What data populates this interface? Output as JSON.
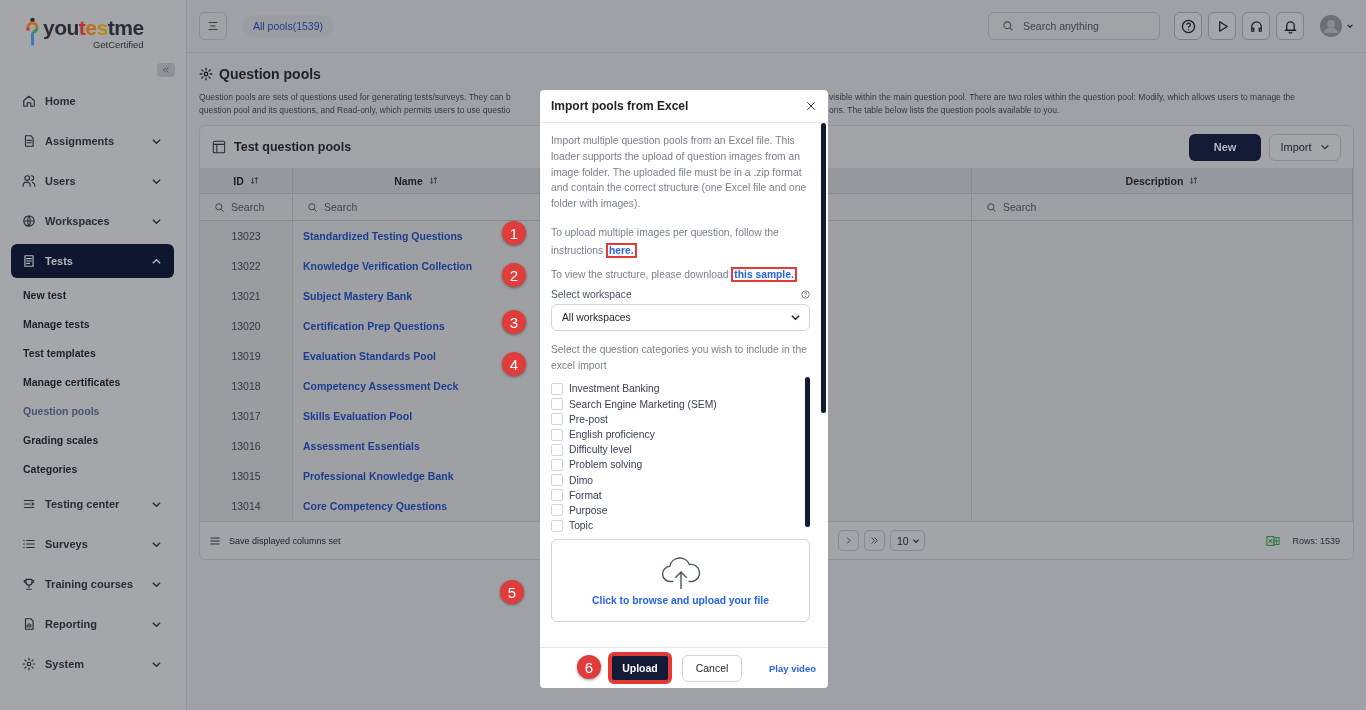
{
  "sidebar": {
    "logo": {
      "wordmark": "youtestme",
      "tagline": "GetCertified"
    },
    "items": [
      {
        "label": "Home",
        "selected": false
      },
      {
        "label": "Assignments",
        "selected": false,
        "expanded": false
      },
      {
        "label": "Users",
        "selected": false,
        "expanded": false
      },
      {
        "label": "Workspaces",
        "selected": false,
        "expanded": false
      },
      {
        "label": "Tests",
        "selected": true,
        "expanded": true,
        "children": [
          {
            "label": "New test",
            "selected": false
          },
          {
            "label": "Manage tests",
            "selected": false
          },
          {
            "label": "Test templates",
            "selected": false
          },
          {
            "label": "Manage certificates",
            "selected": false
          },
          {
            "label": "Question pools",
            "selected": true
          },
          {
            "label": "Grading scales",
            "selected": false
          },
          {
            "label": "Categories",
            "selected": false
          }
        ]
      },
      {
        "label": "Testing center",
        "selected": false,
        "expanded": false
      },
      {
        "label": "Surveys",
        "selected": false,
        "expanded": false
      },
      {
        "label": "Training courses",
        "selected": false,
        "expanded": false
      },
      {
        "label": "Reporting",
        "selected": false,
        "expanded": false
      },
      {
        "label": "System",
        "selected": false,
        "expanded": false
      }
    ]
  },
  "topbar": {
    "chip": "All pools(1539)",
    "search": {
      "placeholder": "Search anything"
    }
  },
  "page": {
    "title": "Question pools",
    "description_left": [
      "Question pools are sets of questions used for generating tests/surveys. They can b",
      "question pool and its questions, and Read-only, which permits users to use questio"
    ],
    "description_right": [
      "visible within the main question pool. There are two roles within the question pool: Modify, which allows users to manage the",
      "ons. The table below lists the question pools available to you."
    ]
  },
  "card": {
    "title": "Test question pools",
    "buttons": [
      {
        "label": "New",
        "kind": "primary"
      },
      {
        "label": "Import",
        "kind": "dropdown"
      }
    ],
    "table": {
      "columns": [
        {
          "label": "ID",
          "placeholder": "Search"
        },
        {
          "label": "Name",
          "placeholder": "Search"
        },
        {
          "label": "Description",
          "placeholder": "Search"
        }
      ],
      "rows": [
        {
          "id": "13023",
          "name": "Standardized Testing Questions"
        },
        {
          "id": "13022",
          "name": "Knowledge Verification Collection"
        },
        {
          "id": "13021",
          "name": "Subject Mastery Bank"
        },
        {
          "id": "13020",
          "name": "Certification Prep Questions"
        },
        {
          "id": "13019",
          "name": "Evaluation Standards Pool"
        },
        {
          "id": "13018",
          "name": "Competency Assessment Deck"
        },
        {
          "id": "13017",
          "name": "Skills Evaluation Pool"
        },
        {
          "id": "13016",
          "name": "Assessment Essentials"
        },
        {
          "id": "13015",
          "name": "Professional Knowledge Bank"
        },
        {
          "id": "13014",
          "name": "Core Competency Questions"
        }
      ]
    },
    "footer": {
      "save_label": "Save displayed columns set",
      "page_size": "10",
      "rows": "Rows: 1539"
    }
  },
  "modal": {
    "title": "Import pools from Excel",
    "intro": "Import multiple question pools from an Excel file. This loader supports the upload of question images from an image folder. The uploaded file must be in a .zip format and contain the correct structure (one Excel file and one folder with images).",
    "instructions": {
      "text": "To upload multiple images per question, follow the instructions",
      "link": "here.",
      "highlighted": true
    },
    "sample": {
      "text": "To view the structure, please download",
      "link": "this sample.",
      "highlighted": true
    },
    "workspace": {
      "label": "Select workspace",
      "value": "All workspaces"
    },
    "categories": {
      "label": "Select the question categories you wish to include in the excel import",
      "items": [
        {
          "label": "Investment Banking",
          "checked": false
        },
        {
          "label": "Search Engine Marketing (SEM)",
          "checked": false
        },
        {
          "label": "Pre-post",
          "checked": false
        },
        {
          "label": "English proficiency",
          "checked": false
        },
        {
          "label": "Difficulty level",
          "checked": false
        },
        {
          "label": "Problem solving",
          "checked": false
        },
        {
          "label": "Dimo",
          "checked": false
        },
        {
          "label": "Format",
          "checked": false
        },
        {
          "label": "Purpose",
          "checked": false
        },
        {
          "label": "Topic",
          "checked": false
        }
      ]
    },
    "upload": {
      "label": "Click to browse and upload your file"
    },
    "buttons": [
      {
        "label": "Upload",
        "kind": "primary",
        "highlighted": true
      },
      {
        "label": "Cancel",
        "kind": "secondary",
        "highlighted": false
      },
      {
        "label": "Play video",
        "kind": "link",
        "highlighted": false
      }
    ]
  },
  "annotations": [
    {
      "number": "1"
    },
    {
      "number": "2"
    },
    {
      "number": "3"
    },
    {
      "number": "4"
    },
    {
      "number": "5"
    },
    {
      "number": "6"
    }
  ]
}
